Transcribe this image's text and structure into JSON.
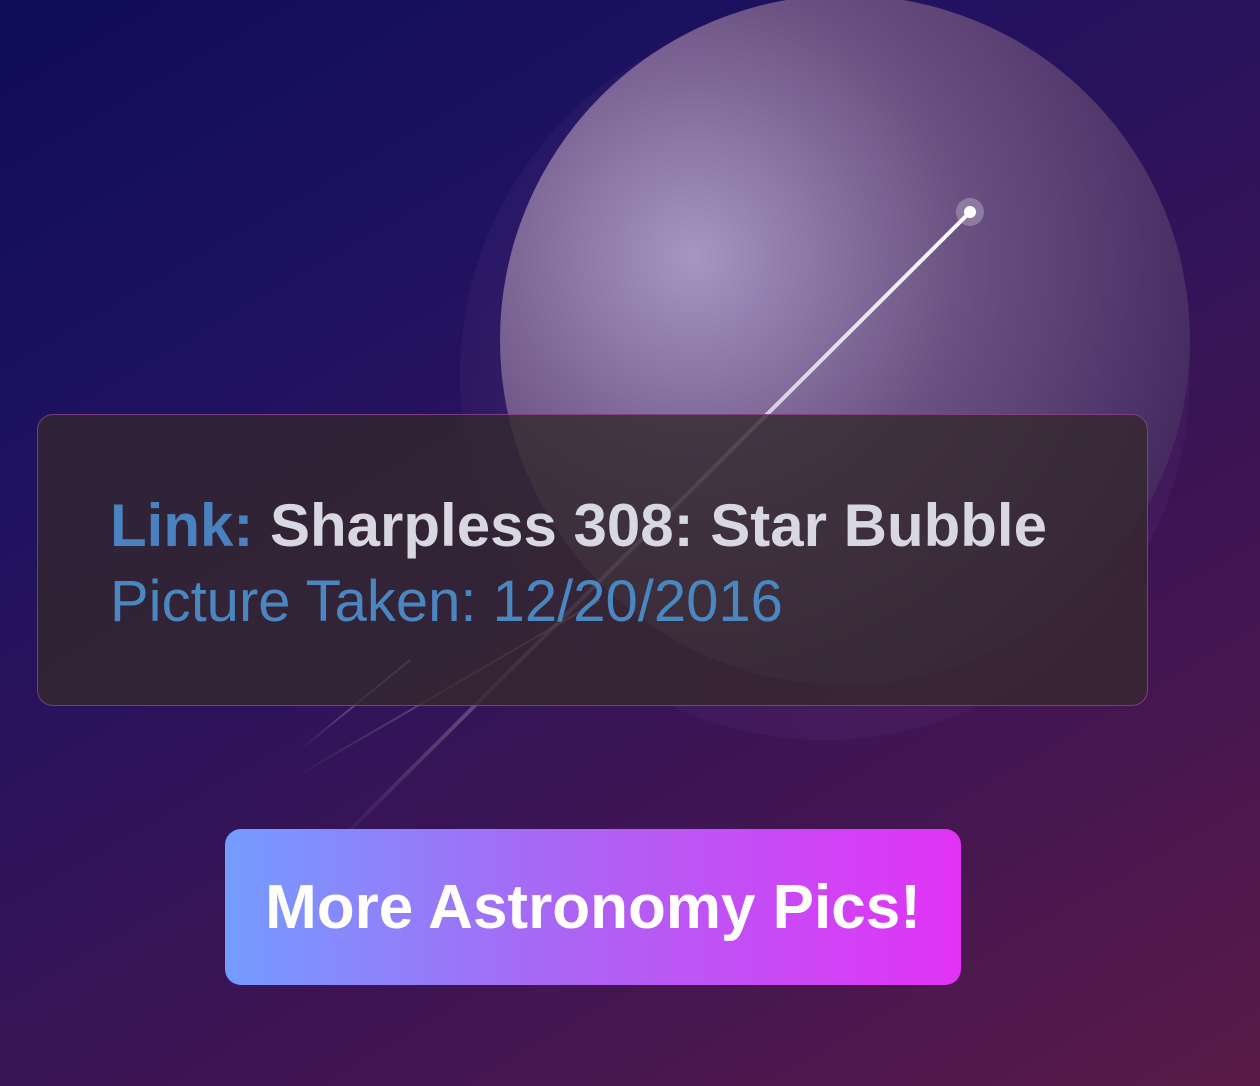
{
  "card": {
    "link_label": "Link:",
    "link_title": "Sharpless 308: Star Bubble",
    "date_label": "Picture Taken:",
    "date_value": "12/20/2016"
  },
  "button": {
    "label": "More Astronomy Pics!"
  },
  "colors": {
    "link_label": "#4a82bf",
    "title_text": "#d8d8e2",
    "date_text": "#4a86c0",
    "button_gradient_start": "#749cff",
    "button_gradient_end": "#e232f6"
  }
}
